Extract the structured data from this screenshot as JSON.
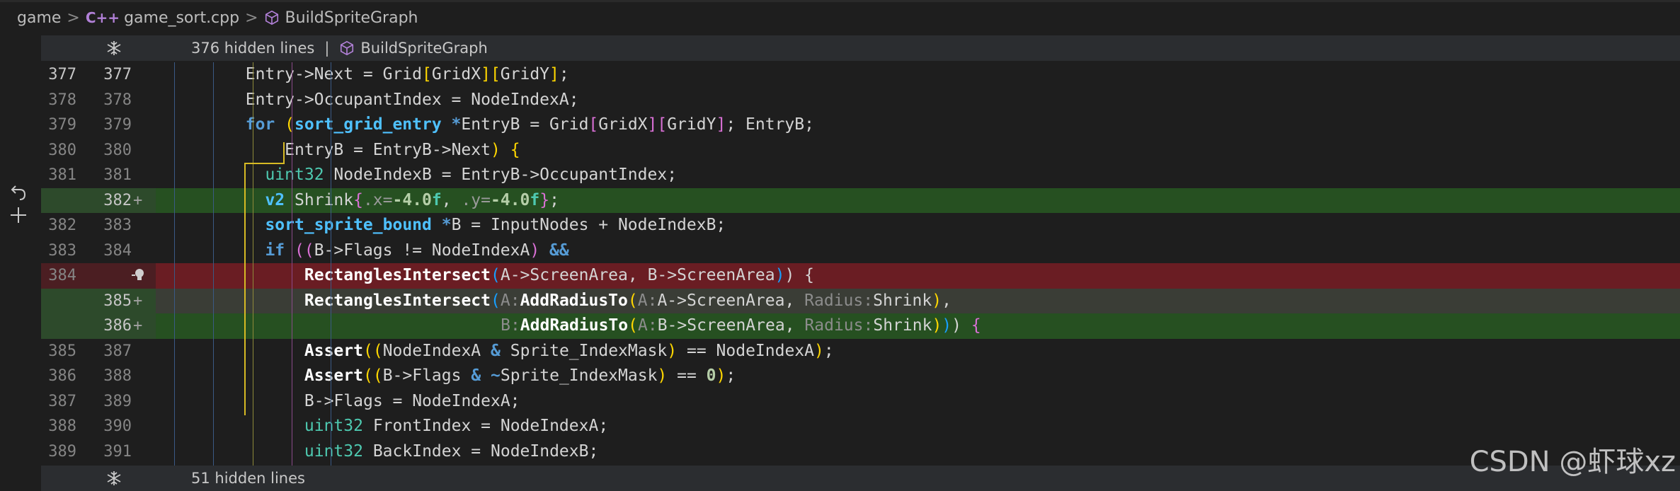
{
  "breadcrumb": {
    "folder": "game",
    "file_badge": "C++",
    "file": "game_sort.cpp",
    "symbol": "BuildSpriteGraph",
    "separator": ">"
  },
  "hidden_top": {
    "text": "376 hidden lines",
    "separator": "|",
    "symbol": "BuildSpriteGraph"
  },
  "hidden_bottom": {
    "text": "51 hidden lines"
  },
  "lines": [
    {
      "old": "377",
      "new": "377",
      "kind": "ctx",
      "indent": 9,
      "tokens": [
        [
          "Entry->Next = Grid",
          "op"
        ],
        [
          "[",
          "br1"
        ],
        [
          "GridX",
          "op"
        ],
        [
          "][",
          "br1"
        ],
        [
          "GridY",
          "op"
        ],
        [
          "]",
          "br1"
        ],
        [
          ";",
          "op"
        ]
      ]
    },
    {
      "old": "378",
      "new": "378",
      "kind": "ctx",
      "indent": 9,
      "tokens": [
        [
          "Entry->OccupantIndex = NodeIndexA;",
          "op"
        ]
      ]
    },
    {
      "old": "379",
      "new": "379",
      "kind": "ctx",
      "indent": 9,
      "tokens": [
        [
          "for ",
          "kw"
        ],
        [
          "(",
          "br1"
        ],
        [
          "sort_grid_entry ",
          "typeb"
        ],
        [
          "*",
          "kw"
        ],
        [
          "EntryB = Grid",
          "op"
        ],
        [
          "[",
          "br2"
        ],
        [
          "GridX",
          "op"
        ],
        [
          "][",
          "br2"
        ],
        [
          "GridY",
          "op"
        ],
        [
          "]",
          "br2"
        ],
        [
          "; EntryB;",
          "op"
        ]
      ]
    },
    {
      "old": "380",
      "new": "380",
      "kind": "ctx",
      "indent": 13,
      "tokens": [
        [
          "EntryB = EntryB->Next",
          ""
        ],
        [
          ")",
          "br1"
        ],
        [
          " ",
          ""
        ],
        [
          "{",
          "br1"
        ]
      ]
    },
    {
      "old": "381",
      "new": "381",
      "kind": "ctx",
      "indent": 11,
      "tokens": [
        [
          "uint32 ",
          "type"
        ],
        [
          "NodeIndexB = EntryB->OccupantIndex;",
          "op"
        ]
      ]
    },
    {
      "old": "",
      "new": "382",
      "kind": "add",
      "indent": 11,
      "tokens": [
        [
          "v2 ",
          "typeb"
        ],
        [
          "Shrink",
          "op"
        ],
        [
          "{",
          "br2"
        ],
        [
          ".x=",
          "field"
        ],
        [
          "-4.0",
          "num"
        ],
        [
          "f",
          "numf"
        ],
        [
          ", ",
          "op"
        ],
        [
          ".y=",
          "field"
        ],
        [
          "-4.0",
          "num"
        ],
        [
          "f",
          "numf"
        ],
        [
          "}",
          "br2"
        ],
        [
          ";",
          "op"
        ]
      ]
    },
    {
      "old": "382",
      "new": "383",
      "kind": "ctx",
      "indent": 11,
      "tokens": [
        [
          "sort_sprite_bound ",
          "typeb"
        ],
        [
          "*",
          "kw"
        ],
        [
          "B = InputNodes + NodeIndexB;",
          "op"
        ]
      ]
    },
    {
      "old": "383",
      "new": "384",
      "kind": "ctx",
      "indent": 11,
      "tokens": [
        [
          "if ",
          "kw"
        ],
        [
          "((",
          "br2"
        ],
        [
          "B->Flags != NodeIndexA",
          ""
        ],
        [
          ")",
          "br2"
        ],
        [
          " &&",
          "kw"
        ]
      ]
    },
    {
      "old": "384",
      "new": "",
      "kind": "del",
      "indent": 15,
      "tokens": [
        [
          "RectanglesIntersect",
          "fn"
        ],
        [
          "(",
          "br3"
        ],
        [
          "A->ScreenArea, B->ScreenArea",
          ""
        ],
        [
          ")",
          "br3"
        ],
        [
          ") {",
          "op"
        ]
      ]
    },
    {
      "old": "",
      "new": "385",
      "kind": "wrapadd",
      "indent": 15,
      "tokens": [
        [
          "RectanglesIntersect",
          "fn"
        ],
        [
          "(",
          "br3"
        ],
        [
          "A:",
          "hint"
        ],
        [
          "AddRadiusTo",
          "fn"
        ],
        [
          "(",
          "br1"
        ],
        [
          "A:",
          "hint"
        ],
        [
          "A->ScreenArea, ",
          ""
        ],
        [
          "Radius:",
          "hint"
        ],
        [
          "Shrink",
          ""
        ],
        [
          ")",
          "br1"
        ],
        [
          ",",
          ""
        ]
      ]
    },
    {
      "old": "",
      "new": "386",
      "kind": "add",
      "indent": 35,
      "tokens": [
        [
          "B:",
          "hint"
        ],
        [
          "AddRadiusTo",
          "fn"
        ],
        [
          "(",
          "br1"
        ],
        [
          "A:",
          "hint"
        ],
        [
          "B->ScreenArea, ",
          ""
        ],
        [
          "Radius:",
          "hint"
        ],
        [
          "Shrink",
          ""
        ],
        [
          ")",
          "br1"
        ],
        [
          ")",
          "br3"
        ],
        [
          ") ",
          ""
        ],
        [
          "{",
          "br2"
        ]
      ]
    },
    {
      "old": "385",
      "new": "387",
      "kind": "ctx",
      "indent": 15,
      "tokens": [
        [
          "Assert",
          "fn"
        ],
        [
          "((",
          "br1"
        ],
        [
          "NodeIndexA ",
          ""
        ],
        [
          "& ",
          "kw"
        ],
        [
          "Sprite_IndexMask",
          ""
        ],
        [
          ")",
          "br1"
        ],
        [
          " == NodeIndexA",
          ""
        ],
        [
          ")",
          "br1"
        ],
        [
          ";",
          ""
        ]
      ]
    },
    {
      "old": "386",
      "new": "388",
      "kind": "ctx",
      "indent": 15,
      "tokens": [
        [
          "Assert",
          "fn"
        ],
        [
          "((",
          "br1"
        ],
        [
          "B->Flags ",
          ""
        ],
        [
          "& ~",
          "kw"
        ],
        [
          "Sprite_IndexMask",
          ""
        ],
        [
          ")",
          "br1"
        ],
        [
          " == ",
          ""
        ],
        [
          "0",
          "num"
        ],
        [
          ")",
          "br1"
        ],
        [
          ";",
          ""
        ]
      ]
    },
    {
      "old": "387",
      "new": "389",
      "kind": "ctx",
      "indent": 15,
      "tokens": [
        [
          "B->Flags = NodeIndexA;",
          ""
        ]
      ]
    },
    {
      "old": "388",
      "new": "390",
      "kind": "ctx",
      "indent": 15,
      "tokens": [
        [
          "uint32 ",
          "type"
        ],
        [
          "FrontIndex = NodeIndexA;",
          ""
        ]
      ]
    },
    {
      "old": "389",
      "new": "391",
      "kind": "ctx",
      "indent": 15,
      "tokens": [
        [
          "uint32 ",
          "type"
        ],
        [
          "BackIndex = NodeIndexB;",
          ""
        ]
      ]
    }
  ],
  "colors": {
    "keyword": "#569cd6",
    "type": "#4ec9b0",
    "add_bg": "#265021",
    "del_bg": "#6a1d23",
    "guide_yellow": "#d7ba24"
  },
  "watermark": "CSDN @虾球xz"
}
